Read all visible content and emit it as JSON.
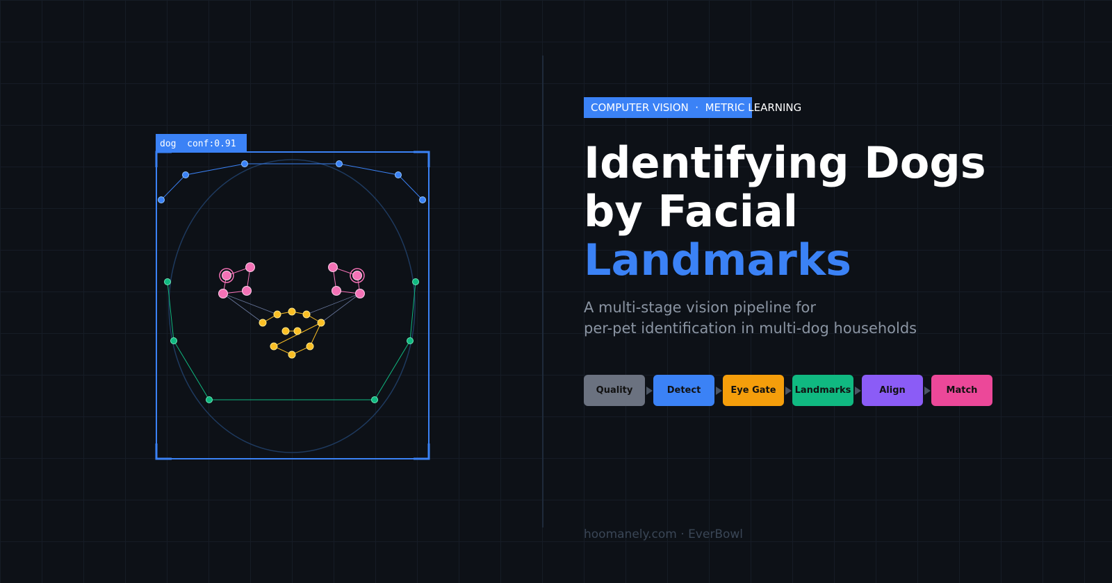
{
  "detection": {
    "label": "dog  conf:0.91"
  },
  "colors": {
    "box": "#3b82f6",
    "ears": "#3b82f6",
    "eyes": "#f472b6",
    "nose": "#fbbf24",
    "jaw": "#10b981",
    "head_outline": "#1e3a5f"
  },
  "header": {
    "tag": "COMPUTER VISION  ·  METRIC LEARNING",
    "title_line1": "Identifying Dogs",
    "title_line2": "by Facial",
    "title_line3": "Landmarks",
    "subtitle_line1": "A multi-stage vision pipeline for",
    "subtitle_line2": "per-pet identification in multi-dog households"
  },
  "pipeline": {
    "stages": [
      {
        "label": "Quality",
        "color": "#6b7280"
      },
      {
        "label": "Detect",
        "color": "#3b82f6"
      },
      {
        "label": "Eye Gate",
        "color": "#f59e0b"
      },
      {
        "label": "Landmarks",
        "color": "#10b981"
      },
      {
        "label": "Align",
        "color": "#8b5cf6"
      },
      {
        "label": "Match",
        "color": "#ec4899"
      }
    ]
  },
  "footer": {
    "text": "hoomanely.com · EverBowl"
  }
}
